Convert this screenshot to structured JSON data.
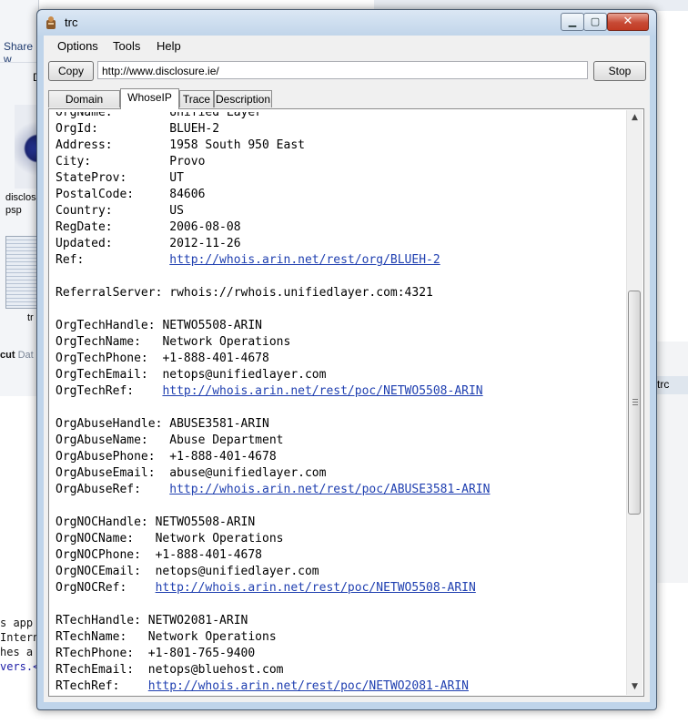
{
  "background": {
    "share_label": "Share w",
    "d_label": "D",
    "file1_label": "disclos\npsp",
    "file2_label": "tr",
    "cut_label": "cut",
    "date_label": "Dat",
    "code_lines": [
      "s app",
      "Intern",
      "hes a",
      "vers.</li>"
    ],
    "right_window_title": "trc"
  },
  "window": {
    "title": "trc",
    "menu": [
      "Options",
      "Tools",
      "Help"
    ],
    "copy_label": "Copy",
    "stop_label": "Stop",
    "url": "http://www.disclosure.ie/",
    "tabs": [
      "Domain WhoIs",
      "WhoseIP",
      "Trace",
      "Description"
    ],
    "active_tab": "WhoseIP"
  },
  "whois_lines": [
    {
      "k": "OrgName:",
      "v": "Unified Layer",
      "c": 16
    },
    {
      "k": "OrgId:",
      "v": "BLUEH-2",
      "c": 16
    },
    {
      "k": "Address:",
      "v": "1958 South 950 East",
      "c": 16
    },
    {
      "k": "City:",
      "v": "Provo",
      "c": 16
    },
    {
      "k": "StateProv:",
      "v": "UT",
      "c": 16
    },
    {
      "k": "PostalCode:",
      "v": "84606",
      "c": 16
    },
    {
      "k": "Country:",
      "v": "US",
      "c": 16
    },
    {
      "k": "RegDate:",
      "v": "2006-08-08",
      "c": 16
    },
    {
      "k": "Updated:",
      "v": "2012-11-26",
      "c": 16
    },
    {
      "k": "Ref:",
      "v": "http://whois.arin.net/rest/org/BLUEH-2",
      "c": 16,
      "link": true
    },
    {
      "k": "",
      "v": ""
    },
    {
      "k": "ReferralServer:",
      "v": "rwhois://rwhois.unifiedlayer.com:4321",
      "c": 16
    },
    {
      "k": "",
      "v": ""
    },
    {
      "k": "OrgTechHandle:",
      "v": "NETWO5508-ARIN",
      "c": 15
    },
    {
      "k": "OrgTechName:",
      "v": "Network Operations",
      "c": 15
    },
    {
      "k": "OrgTechPhone:",
      "v": "+1-888-401-4678",
      "c": 15
    },
    {
      "k": "OrgTechEmail:",
      "v": "netops@unifiedlayer.com",
      "c": 15
    },
    {
      "k": "OrgTechRef:",
      "v": "http://whois.arin.net/rest/poc/NETWO5508-ARIN",
      "c": 15,
      "link": true
    },
    {
      "k": "",
      "v": ""
    },
    {
      "k": "OrgAbuseHandle:",
      "v": "ABUSE3581-ARIN",
      "c": 16
    },
    {
      "k": "OrgAbuseName:",
      "v": "Abuse Department",
      "c": 16
    },
    {
      "k": "OrgAbusePhone:",
      "v": "+1-888-401-4678",
      "c": 16
    },
    {
      "k": "OrgAbuseEmail:",
      "v": "abuse@unifiedlayer.com",
      "c": 16
    },
    {
      "k": "OrgAbuseRef:",
      "v": "http://whois.arin.net/rest/poc/ABUSE3581-ARIN",
      "c": 16,
      "link": true
    },
    {
      "k": "",
      "v": ""
    },
    {
      "k": "OrgNOCHandle:",
      "v": "NETWO5508-ARIN",
      "c": 14
    },
    {
      "k": "OrgNOCName:",
      "v": "Network Operations",
      "c": 14
    },
    {
      "k": "OrgNOCPhone:",
      "v": "+1-888-401-4678",
      "c": 14
    },
    {
      "k": "OrgNOCEmail:",
      "v": "netops@unifiedlayer.com",
      "c": 14
    },
    {
      "k": "OrgNOCRef:",
      "v": "http://whois.arin.net/rest/poc/NETWO5508-ARIN",
      "c": 14,
      "link": true
    },
    {
      "k": "",
      "v": ""
    },
    {
      "k": "RTechHandle:",
      "v": "NETWO2081-ARIN",
      "c": 13
    },
    {
      "k": "RTechName:",
      "v": "Network Operations",
      "c": 13
    },
    {
      "k": "RTechPhone:",
      "v": "+1-801-765-9400",
      "c": 13
    },
    {
      "k": "RTechEmail:",
      "v": "netops@bluehost.com",
      "c": 13
    },
    {
      "k": "RTechRef:",
      "v": "http://whois.arin.net/rest/poc/NETWO2081-ARIN",
      "c": 13,
      "link": true
    }
  ],
  "colors": {
    "link": "#1f3fb0",
    "close_button": "#c74a35",
    "titlebar": "#c1d5ea"
  }
}
